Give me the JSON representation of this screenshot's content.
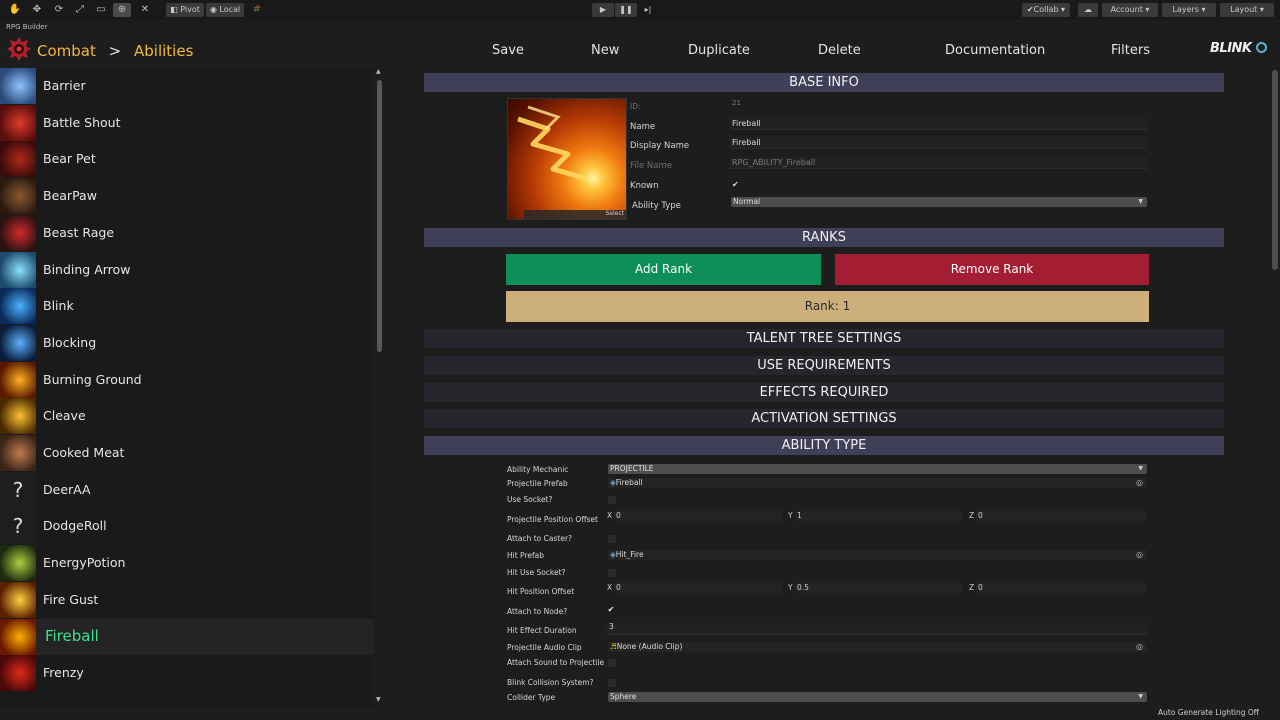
{
  "toolbar": {
    "pivot_label": "Pivot",
    "local_label": "Local",
    "collab_label": "Collab",
    "account_label": "Account",
    "layers_label": "Layers",
    "layout_label": "Layout"
  },
  "window_title": "RPG Builder",
  "breadcrumb": {
    "root": "Combat",
    "separator": ">",
    "current": "Abilities"
  },
  "nav": [
    "Save",
    "New",
    "Duplicate",
    "Delete",
    "Documentation",
    "Filters"
  ],
  "brand": "BLINK",
  "colors": {
    "accent": "#f2b840",
    "active_item": "#3ee08a",
    "add_rank": "#0f8f58",
    "remove_rank": "#a31d33",
    "rank_bar": "#cdaf7b",
    "section": "#3f3f57"
  },
  "sidebar": {
    "items": [
      {
        "label": "Barrier",
        "icon": "barrier-icon",
        "c1": "#2a4a7a",
        "c2": "#8fc4ff"
      },
      {
        "label": "Battle Shout",
        "icon": "battle-shout-icon",
        "c1": "#5a0d0d",
        "c2": "#e03a2a"
      },
      {
        "label": "Bear Pet",
        "icon": "bear-pet-icon",
        "c1": "#3a0b0b",
        "c2": "#b02a1a"
      },
      {
        "label": "BearPaw",
        "icon": "bear-paw-icon",
        "c1": "#2c1a10",
        "c2": "#8a5a30"
      },
      {
        "label": "Beast Rage",
        "icon": "beast-rage-icon",
        "c1": "#2a1212",
        "c2": "#d42a2a"
      },
      {
        "label": "Binding Arrow",
        "icon": "binding-arrow-icon",
        "c1": "#1c4a6a",
        "c2": "#8ae0ff"
      },
      {
        "label": "Blink",
        "icon": "blink-icon",
        "c1": "#0a2a5a",
        "c2": "#4ab0ff"
      },
      {
        "label": "Blocking",
        "icon": "blocking-icon",
        "c1": "#0a1c3a",
        "c2": "#5ab0ff"
      },
      {
        "label": "Burning Ground",
        "icon": "burning-ground-icon",
        "c1": "#5a1a00",
        "c2": "#ffb020"
      },
      {
        "label": "Cleave",
        "icon": "cleave-icon",
        "c1": "#4a2a00",
        "c2": "#ffc030"
      },
      {
        "label": "Cooked Meat",
        "icon": "cooked-meat-icon",
        "c1": "#3a2418",
        "c2": "#c07a50"
      },
      {
        "label": "DeerAA",
        "icon": "question-icon",
        "c1": "#1c1c1c",
        "c2": "#2a2a2a"
      },
      {
        "label": "DodgeRoll",
        "icon": "question-icon",
        "c1": "#1c1c1c",
        "c2": "#2a2a2a"
      },
      {
        "label": "EnergyPotion",
        "icon": "energy-potion-icon",
        "c1": "#1c2a10",
        "c2": "#b0d040"
      },
      {
        "label": "Fire Gust",
        "icon": "fire-gust-icon",
        "c1": "#5a2000",
        "c2": "#ffd040"
      },
      {
        "label": "Fireball",
        "icon": "fireball-icon",
        "c1": "#6a1800",
        "c2": "#ffb000",
        "active": true
      },
      {
        "label": "Frenzy",
        "icon": "frenzy-icon",
        "c1": "#4a0808",
        "c2": "#e02a1a"
      }
    ]
  },
  "base_info": {
    "title": "BASE INFO",
    "select_label": "Select",
    "rows": [
      {
        "label": "ID:",
        "value": "21",
        "dim": true
      },
      {
        "label": "Name",
        "value": "Fireball"
      },
      {
        "label": "Display Name",
        "value": "Fireball"
      },
      {
        "label": "File Name",
        "value": "RPG_ABILITY_Fireball",
        "dim": true
      },
      {
        "label": "Known",
        "value": "✔"
      },
      {
        "label": "Ability Type",
        "value": "Normal"
      }
    ]
  },
  "ranks": {
    "title": "RANKS",
    "add_label": "Add Rank",
    "remove_label": "Remove Rank",
    "rank_label": "Rank: 1"
  },
  "collapsed_sections": [
    "TALENT TREE SETTINGS",
    "USE REQUIREMENTS",
    "EFFECTS REQUIRED",
    "ACTIVATION SETTINGS"
  ],
  "ability_type": {
    "title": "ABILITY TYPE",
    "mechanic": {
      "label": "Ability Mechanic",
      "value": "PROJECTILE"
    },
    "projectile_prefab": {
      "label": "Projectile Prefab",
      "value": "Fireball"
    },
    "use_socket": {
      "label": "Use Socket?"
    },
    "proj_offset": {
      "label": "Projectile Position Offset",
      "x": "0",
      "y": "1",
      "z": "0"
    },
    "attach_caster": {
      "label": "Attach to Caster?"
    },
    "hit_prefab": {
      "label": "Hit Prefab",
      "value": "Hit_Fire"
    },
    "hit_socket": {
      "label": "Hit Use Socket?"
    },
    "hit_offset": {
      "label": "Hit Position Offset",
      "x": "0",
      "y": "0.5",
      "z": "0"
    },
    "attach_node": {
      "label": "Attach to Node?",
      "value": "✔"
    },
    "hit_duration": {
      "label": "Hit Effect Duration",
      "value": "3"
    },
    "audio_clip": {
      "label": "Projectile Audio Clip",
      "value": "None (Audio Clip)"
    },
    "attach_sound": {
      "label": "Attach Sound to Projectile"
    },
    "blink_collision": {
      "label": "Blink Collision System?"
    },
    "collider_type": {
      "label": "Collider Type",
      "value": "Sphere"
    }
  },
  "axis_labels": {
    "x": "X",
    "y": "Y",
    "z": "Z"
  },
  "status_text": "Auto Generate Lighting Off"
}
